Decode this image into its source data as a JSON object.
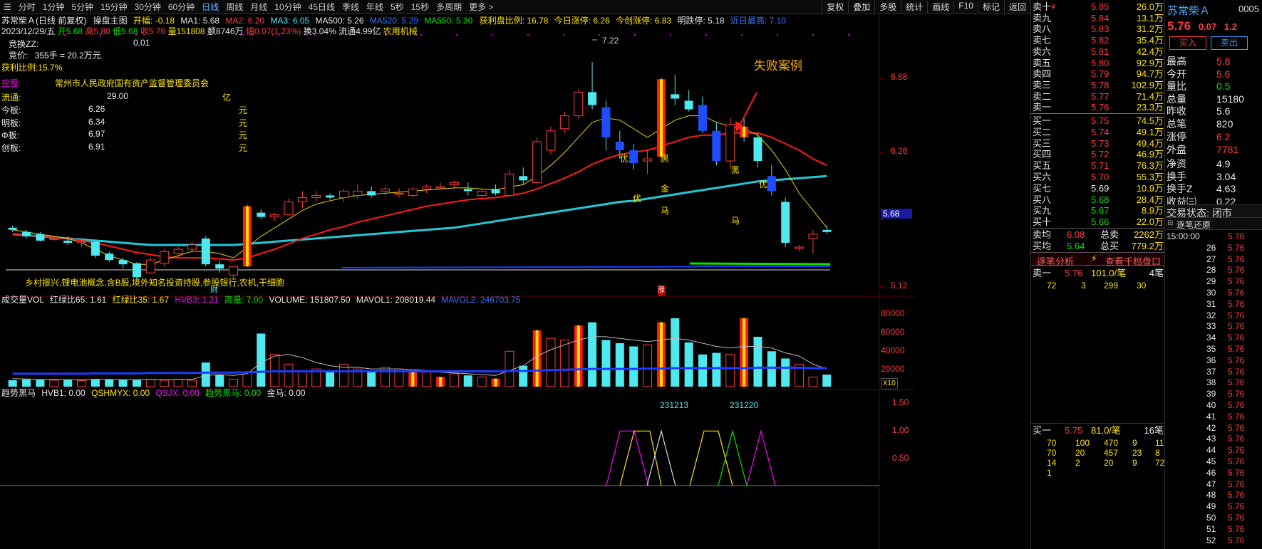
{
  "period_tabs": [
    "分时",
    "1分钟",
    "5分钟",
    "15分钟",
    "30分钟",
    "60分钟",
    "日线",
    "周线",
    "月线",
    "10分钟",
    "45日线",
    "季线",
    "年线",
    "5秒",
    "15秒",
    "多周期",
    "更多 >"
  ],
  "active_tab": "日线",
  "toolbar": [
    "复权",
    "叠加",
    "多股",
    "统计",
    "画线",
    "F10",
    "标记",
    "返回"
  ],
  "info": {
    "stock_title": "苏常柴Ａ(日线 前复权)",
    "chart_mode": "操盘主图",
    "kaifu": "开幅: -0.18",
    "ma1": "MA1: 5.68",
    "ma2": "MA2: 6.20",
    "ma3": "MA3: 6.05",
    "ma500": "MA500: 5.26",
    "ma520": "MA520: 5.29",
    "ma550": "MA550: 5.30",
    "profit_ratio": "获利盘比例: 16.78",
    "limit_up_today": "今日涨停: 6.26",
    "limit_up_chinext": "今创涨停: 6.83",
    "limit_down_tomorrow": "明跌停: 5.18",
    "near_high": "近日最高: 7.10",
    "date_line": "2023/12/29/五",
    "open": "开5.68",
    "high": "高5.80",
    "low": "低5.68",
    "close": "收5.76",
    "volume": "量151808",
    "amount": "额8746万",
    "change": "幅0.07(1.23%)",
    "turnover": "换3.04%",
    "float_cap": "流通4.99亿",
    "industry": "农用机械"
  },
  "left_panel": {
    "jhzz_label": "竞换ZZ:",
    "jhzz_value": "0.01",
    "bid_label": "竞价:",
    "bid_value": "355手 = 20.2万元",
    "profit_label": "获利比例:15.7%",
    "holder_label": "控股:",
    "holder_value": "常州市人民政府国有资产监督管理委员会",
    "float_label": "流通:",
    "float_value": "29.00",
    "float_unit": "亿",
    "rows": [
      {
        "label": "今板:",
        "value": "6.26",
        "unit": "元"
      },
      {
        "label": "明板:",
        "value": "6.34",
        "unit": "元"
      },
      {
        "label": "Φ板:",
        "value": "6.97",
        "unit": "元"
      },
      {
        "label": "创板:",
        "value": "6.91",
        "unit": "元"
      }
    ]
  },
  "concepts": "乡村振兴,锂电池概念,含B股,境外知名投资持股,参股银行,农机,干细胞",
  "annotation": "失败案例",
  "chart_marks": {
    "cai": "财",
    "zhang": "涨",
    "you": "优",
    "hei": "黑",
    "jin": "金",
    "ma": "马"
  },
  "price_axis": [
    "6.88",
    "6.26",
    "5.68",
    "5.12"
  ],
  "current_price_tag": "5.68",
  "peak_label": "7.22",
  "vol_panel": {
    "title": "成交量VOL",
    "hlb65": "红绿比65: 1.61",
    "hlb35": "红绿比35: 1.67",
    "hvb3": "HVB3: 1.21",
    "gaoliang": "高量: 7.00",
    "volume": "VOLUME: 151807.50",
    "mavol1": "MAVOL1: 208019.44",
    "mavol2": "MAVOL2: 246703.75",
    "axis": [
      "80000",
      "60000",
      "40000",
      "20000"
    ],
    "x10": "X10"
  },
  "trend_panel": {
    "title": "趋势黑马",
    "hvb1": "HVB1: 0.00",
    "qshmyx": "QSHMYX: 0.00",
    "qsjx": "QSJX: 0.00",
    "qsheima": "趋势黑马: 0.00",
    "jinma": "金马: 0.00",
    "axis": [
      "1.50",
      "1.00",
      "0.50"
    ],
    "date1": "231213",
    "date2": "231220"
  },
  "chart_data": {
    "type": "candlestick",
    "candles": [
      [
        5.68,
        5.7,
        5.64,
        5.66
      ],
      [
        5.64,
        5.66,
        5.58,
        5.6
      ],
      [
        5.62,
        5.64,
        5.55,
        5.56
      ],
      [
        5.58,
        5.6,
        5.56,
        5.58
      ],
      [
        5.56,
        5.6,
        5.52,
        5.54
      ],
      [
        5.55,
        5.57,
        5.5,
        5.55
      ],
      [
        5.55,
        5.56,
        5.4,
        5.42
      ],
      [
        5.44,
        5.46,
        5.36,
        5.38
      ],
      [
        5.38,
        5.4,
        5.3,
        5.34
      ],
      [
        5.35,
        5.36,
        5.2,
        5.22
      ],
      [
        5.26,
        5.4,
        5.25,
        5.38
      ],
      [
        5.35,
        5.48,
        5.32,
        5.46
      ],
      [
        5.44,
        5.5,
        5.4,
        5.48
      ],
      [
        5.48,
        5.55,
        5.45,
        5.52
      ],
      [
        5.58,
        5.6,
        5.32,
        5.34
      ],
      [
        5.34,
        5.37,
        5.26,
        5.3
      ],
      [
        5.24,
        5.32,
        5.2,
        5.32
      ],
      [
        5.32,
        5.9,
        5.32,
        5.88
      ],
      [
        5.82,
        5.85,
        5.76,
        5.78
      ],
      [
        5.78,
        5.82,
        5.74,
        5.8
      ],
      [
        5.8,
        5.95,
        5.79,
        5.92
      ],
      [
        5.92,
        6.02,
        5.86,
        5.96
      ],
      [
        5.96,
        6.02,
        5.92,
        5.98
      ],
      [
        5.98,
        6.0,
        5.94,
        5.96
      ],
      [
        5.96,
        6.04,
        5.92,
        6.02
      ],
      [
        5.98,
        6.08,
        5.95,
        6.02
      ],
      [
        6.02,
        6.06,
        5.96,
        5.98
      ],
      [
        6.02,
        6.06,
        5.98,
        6.04
      ],
      [
        6.0,
        6.05,
        5.96,
        6.0
      ],
      [
        5.98,
        6.06,
        5.96,
        6.04
      ],
      [
        6.04,
        6.08,
        6.0,
        6.06
      ],
      [
        6.06,
        6.1,
        6.04,
        6.06
      ],
      [
        6.08,
        6.12,
        6.04,
        6.1
      ],
      [
        6.04,
        6.1,
        5.98,
        6.02
      ],
      [
        5.98,
        6.04,
        5.96,
        6.02
      ],
      [
        6.04,
        6.08,
        5.98,
        6.0
      ],
      [
        5.98,
        6.22,
        5.98,
        6.18
      ],
      [
        6.16,
        6.24,
        6.08,
        6.12
      ],
      [
        6.1,
        6.52,
        6.08,
        6.48
      ],
      [
        6.4,
        6.62,
        6.36,
        6.58
      ],
      [
        6.6,
        6.76,
        6.56,
        6.72
      ],
      [
        6.72,
        6.96,
        6.7,
        6.94
      ],
      [
        6.94,
        7.22,
        6.78,
        6.82
      ],
      [
        6.8,
        6.86,
        6.4,
        6.52
      ],
      [
        6.48,
        6.58,
        6.32,
        6.4
      ],
      [
        6.4,
        6.46,
        6.22,
        6.28
      ],
      [
        6.3,
        6.4,
        6.18,
        6.32
      ],
      [
        6.34,
        7.08,
        6.3,
        7.06
      ],
      [
        6.92,
        7.1,
        6.82,
        6.88
      ],
      [
        6.86,
        6.96,
        6.76,
        6.78
      ],
      [
        6.82,
        6.9,
        6.56,
        6.58
      ],
      [
        6.58,
        6.66,
        6.26,
        6.3
      ],
      [
        6.3,
        6.7,
        6.22,
        6.64
      ],
      [
        6.62,
        6.7,
        6.48,
        6.52
      ],
      [
        6.52,
        6.56,
        6.24,
        6.3
      ],
      [
        6.16,
        6.26,
        5.98,
        6.02
      ],
      [
        5.92,
        5.96,
        5.5,
        5.54
      ],
      [
        5.5,
        5.52,
        5.46,
        5.5
      ],
      [
        5.58,
        5.66,
        5.44,
        5.62
      ],
      [
        5.66,
        5.7,
        5.62,
        5.64
      ]
    ],
    "ma_yellow": [
      5.66,
      5.64,
      5.62,
      5.6,
      5.58,
      5.54,
      5.48,
      5.42,
      5.38,
      5.34,
      5.34,
      5.38,
      5.42,
      5.46,
      5.46,
      5.44,
      5.4,
      5.5,
      5.6,
      5.68,
      5.76,
      5.84,
      5.9,
      5.93,
      5.96,
      5.98,
      5.99,
      6.0,
      6.01,
      6.02,
      6.03,
      6.04,
      6.05,
      6.05,
      6.04,
      6.03,
      6.06,
      6.08,
      6.16,
      6.26,
      6.38,
      6.52,
      6.66,
      6.7,
      6.68,
      6.6,
      6.52,
      6.6,
      6.68,
      6.72,
      6.72,
      6.66,
      6.62,
      6.6,
      6.54,
      6.4,
      6.22,
      6.0,
      5.84,
      5.68
    ],
    "ma_red": [
      5.62,
      5.61,
      5.6,
      5.59,
      5.58,
      5.56,
      5.54,
      5.51,
      5.48,
      5.45,
      5.43,
      5.41,
      5.4,
      5.4,
      5.4,
      5.39,
      5.38,
      5.4,
      5.44,
      5.48,
      5.53,
      5.58,
      5.62,
      5.66,
      5.69,
      5.73,
      5.76,
      5.79,
      5.82,
      5.85,
      5.88,
      5.9,
      5.92,
      5.94,
      5.95,
      5.96,
      5.98,
      6.0,
      6.04,
      6.09,
      6.14,
      6.2,
      6.27,
      6.32,
      6.36,
      6.38,
      6.4,
      6.44,
      6.48,
      6.52,
      6.54,
      6.54,
      6.56,
      6.56,
      6.56,
      6.52,
      6.46,
      6.4,
      6.32,
      6.26
    ],
    "ma_cyan": [
      5.62,
      5.61,
      5.6,
      5.59,
      5.58,
      5.57,
      5.56,
      5.55,
      5.54,
      5.53,
      5.52,
      5.52,
      5.52,
      5.52,
      5.52,
      5.52,
      5.52,
      5.53,
      5.54,
      5.55,
      5.56,
      5.57,
      5.58,
      5.59,
      5.6,
      5.61,
      5.62,
      5.63,
      5.64,
      5.65,
      5.66,
      5.67,
      5.68,
      5.7,
      5.72,
      5.74,
      5.76,
      5.78,
      5.8,
      5.82,
      5.84,
      5.86,
      5.88,
      5.9,
      5.92,
      5.93,
      5.95,
      5.97,
      5.99,
      6.01,
      6.03,
      6.05,
      6.07,
      6.09,
      6.11,
      6.12,
      6.13,
      6.14,
      6.15,
      6.16
    ],
    "ylim": [
      5.05,
      7.3
    ],
    "volume": [
      8000,
      9000,
      8500,
      8000,
      9000,
      7500,
      9500,
      9000,
      9000,
      8500,
      9000,
      8000,
      9000,
      8000,
      30000,
      15000,
      9000,
      18000,
      66000,
      40000,
      28000,
      20000,
      22000,
      20000,
      28000,
      22000,
      20000,
      24000,
      22000,
      20000,
      18000,
      12000,
      16000,
      14000,
      12000,
      10000,
      44000,
      26000,
      70000,
      60000,
      58000,
      76000,
      80000,
      58000,
      54000,
      50000,
      52000,
      80000,
      85000,
      55000,
      40000,
      42000,
      40000,
      85000,
      62000,
      44000,
      35000,
      28000,
      12000,
      15000
    ],
    "mavol1": [
      10000,
      9500,
      9000,
      9000,
      8500,
      8500,
      9000,
      9000,
      8500,
      8500,
      9000,
      8500,
      9000,
      9000,
      14000,
      15000,
      14000,
      16000,
      30000,
      38000,
      40000,
      36000,
      30000,
      26000,
      24000,
      24000,
      22000,
      22000,
      22000,
      21000,
      20000,
      18000,
      17000,
      16000,
      15000,
      14000,
      20000,
      26000,
      38000,
      46000,
      52000,
      58000,
      62000,
      62000,
      60000,
      58000,
      56000,
      58000,
      60000,
      58000,
      54000,
      50000,
      48000,
      50000,
      50000,
      48000,
      42000,
      38000,
      28000,
      22000
    ],
    "mavol2": [
      16000,
      16000,
      16000,
      16000,
      16000,
      16000,
      16500,
      16500,
      16500,
      16500,
      17000,
      17000,
      17000,
      17000,
      17500,
      17500,
      17500,
      18000,
      18500,
      19000,
      19000,
      19000,
      19000,
      19000,
      19000,
      19000,
      19000,
      19000,
      19000,
      19000,
      19000,
      19000,
      19000,
      19000,
      19000,
      19000,
      19500,
      19500,
      20000,
      20500,
      21000,
      21500,
      22000,
      22000,
      22000,
      22000,
      22500,
      22500,
      23000,
      23000,
      23000,
      23000,
      23000,
      23000,
      23500,
      23500,
      23500,
      23500,
      23000,
      23000
    ],
    "vol_max": 100000
  },
  "order_book": {
    "asks": [
      {
        "label": "卖十",
        "flag": "¥",
        "price": "5.85",
        "vol": "26.0万"
      },
      {
        "label": "卖九",
        "price": "5.84",
        "vol": "13.1万"
      },
      {
        "label": "卖八",
        "price": "5.83",
        "vol": "31.2万"
      },
      {
        "label": "卖七",
        "price": "5.82",
        "vol": "35.4万"
      },
      {
        "label": "卖六",
        "price": "5.81",
        "vol": "42.4万"
      },
      {
        "label": "卖五",
        "price": "5.80",
        "vol": "92.9万"
      },
      {
        "label": "卖四",
        "price": "5.79",
        "vol": "94.7万"
      },
      {
        "label": "卖三",
        "price": "5.78",
        "vol": "102.9万"
      },
      {
        "label": "卖二",
        "price": "5.77",
        "vol": "71.4万"
      },
      {
        "label": "卖一",
        "price": "5.76",
        "vol": "23.3万"
      }
    ],
    "bids": [
      {
        "label": "买一",
        "price": "5.75",
        "vol": "74.5万"
      },
      {
        "label": "买二",
        "price": "5.74",
        "vol": "49.1万"
      },
      {
        "label": "买三",
        "price": "5.73",
        "vol": "49.4万"
      },
      {
        "label": "买四",
        "price": "5.72",
        "vol": "46.9万"
      },
      {
        "label": "买五",
        "price": "5.71",
        "vol": "76.3万"
      },
      {
        "label": "买六",
        "price": "5.70",
        "vol": "55.3万"
      },
      {
        "label": "买七",
        "price": "5.69",
        "vol": "10.9万"
      },
      {
        "label": "买八",
        "price": "5.68",
        "vol": "28.4万"
      },
      {
        "label": "买九",
        "price": "5.67",
        "vol": "8.9万"
      },
      {
        "label": "买十",
        "price": "5.66",
        "vol": "22.0万"
      }
    ],
    "avg_sell_label": "卖均",
    "avg_sell": "6.08",
    "total_sell_label": "总卖",
    "total_sell": "2262万",
    "avg_buy_label": "买均",
    "avg_buy": "5.64",
    "total_buy_label": "总买",
    "total_buy": "779.2万",
    "tab1": "逐笔分析",
    "tab2": "查看千档盘口",
    "sell1_label": "卖一",
    "sell1_price": "5.76",
    "sell1_qty": "101.0/笔",
    "sell1_count": "4笔",
    "sell1_orders": [
      "72",
      "3",
      "299",
      "30"
    ],
    "buy1_label": "买一",
    "buy1_price": "5.75",
    "buy1_qty": "81.0/笔",
    "buy1_count": "16笔",
    "buy1_orders": [
      [
        "70",
        "100",
        "470",
        "9",
        "11"
      ],
      [
        "70",
        "20",
        "457",
        "23",
        "8"
      ],
      [
        "14",
        "2",
        "20",
        "9",
        "72"
      ],
      [
        "1",
        "",
        "",
        "",
        ""
      ]
    ]
  },
  "far_panel": {
    "name": "苏常柴Ａ",
    "code": "0005",
    "price": "5.76",
    "chg": "0.07",
    "pct": "1.2",
    "buy_btn": "买入",
    "sell_btn": "卖出",
    "stats": [
      {
        "k": "最高",
        "v": "5.8"
      },
      {
        "k": "今开",
        "v": "5.6"
      },
      {
        "k": "量比",
        "v": "0.5"
      },
      {
        "k": "总量",
        "v": "15180"
      },
      {
        "k": "昨收",
        "v": "5.6"
      },
      {
        "k": "总笔",
        "v": "820"
      },
      {
        "k": "涨停",
        "v": "6.2"
      },
      {
        "k": "外盘",
        "v": "7781"
      },
      {
        "k": "净资",
        "v": "4.9"
      },
      {
        "k": "换手",
        "v": "3.04"
      },
      {
        "k": "换手Z",
        "v": "4.63"
      },
      {
        "k": "收益㈢",
        "v": "0.22"
      }
    ],
    "trade_status": "交易状态: 闭市",
    "tick_header": "逐笔还原",
    "ticks": [
      {
        "t": "15:00:00",
        "p": "5.76"
      },
      {
        "t": "26",
        "p": "5.76"
      },
      {
        "t": "27",
        "p": "5.76"
      },
      {
        "t": "28",
        "p": "5.76"
      },
      {
        "t": "29",
        "p": "5.76"
      },
      {
        "t": "30",
        "p": "5.76"
      },
      {
        "t": "31",
        "p": "5.76"
      },
      {
        "t": "32",
        "p": "5.76"
      },
      {
        "t": "33",
        "p": "5.76"
      },
      {
        "t": "34",
        "p": "5.76"
      },
      {
        "t": "35",
        "p": "5.76"
      },
      {
        "t": "36",
        "p": "5.76"
      },
      {
        "t": "37",
        "p": "5.76"
      },
      {
        "t": "38",
        "p": "5.76"
      },
      {
        "t": "39",
        "p": "5.76"
      },
      {
        "t": "40",
        "p": "5.76"
      },
      {
        "t": "41",
        "p": "5.76"
      },
      {
        "t": "42",
        "p": "5.76"
      },
      {
        "t": "43",
        "p": "5.76"
      },
      {
        "t": "44",
        "p": "5.76"
      },
      {
        "t": "45",
        "p": "5.76"
      },
      {
        "t": "46",
        "p": "5.76"
      },
      {
        "t": "47",
        "p": "5.76"
      },
      {
        "t": "48",
        "p": "5.76"
      },
      {
        "t": "49",
        "p": "5.76"
      },
      {
        "t": "50",
        "p": "5.76"
      },
      {
        "t": "51",
        "p": "5.76"
      },
      {
        "t": "52",
        "p": "5.76"
      }
    ]
  },
  "colors": {
    "up": "#ff3b3b",
    "down": "#4ee8ef",
    "ma_yellow": "#e6d200",
    "ma_red": "#ff1a1a",
    "ma_cyan": "#22c8d8",
    "ma_blue": "#1a3cff",
    "hl": "#ffe600"
  }
}
